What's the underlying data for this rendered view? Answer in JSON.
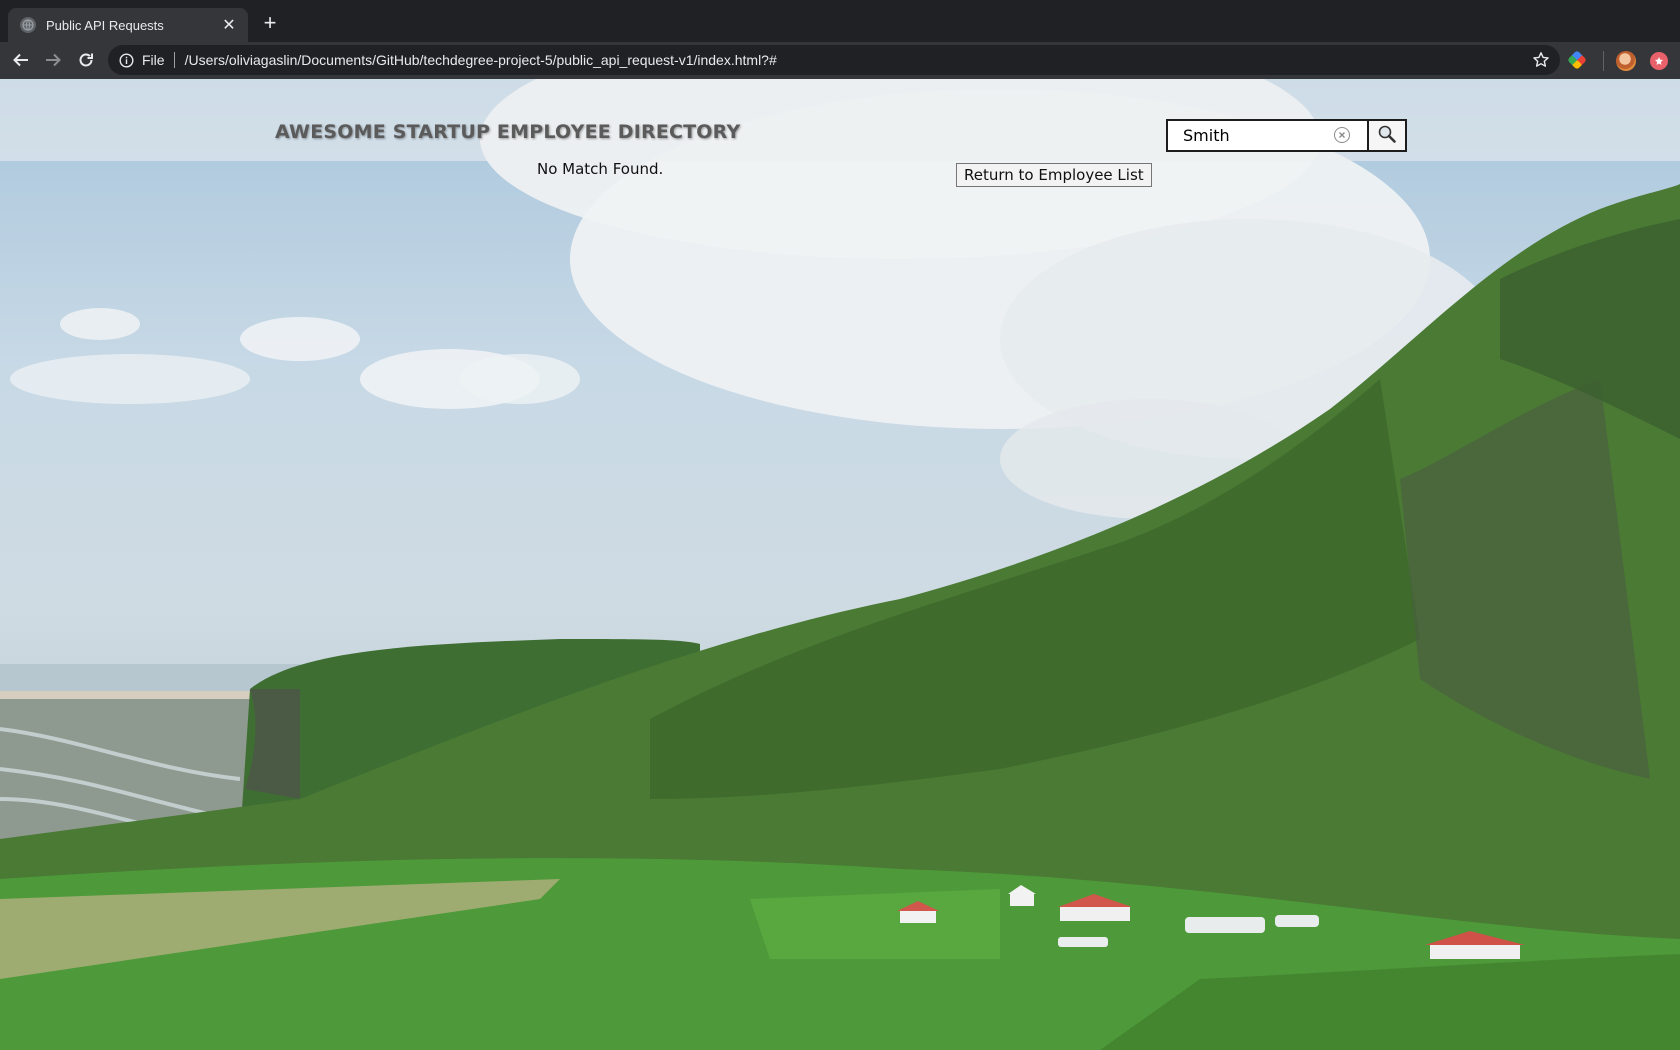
{
  "browser": {
    "tab": {
      "title": "Public API Requests",
      "close_glyph": "✕",
      "favicon": "globe-icon"
    },
    "new_tab_glyph": "+",
    "omnibox": {
      "security_label": "File",
      "url": "/Users/oliviagaslin/Documents/GitHub/techdegree-project-5/public_api_request-v1/index.html?#"
    },
    "nav": {
      "back": "back-arrow-icon",
      "forward": "forward-arrow-icon",
      "reload": "reload-icon"
    },
    "extensions": [
      "color-wheel-icon",
      "profile-avatar-icon",
      "red-badge-icon"
    ]
  },
  "page": {
    "title": "AWESOME STARTUP EMPLOYEE DIRECTORY",
    "search": {
      "value": "Smith",
      "button_icon": "search-icon"
    },
    "message": "No Match Found.",
    "return_button": "Return to Employee List"
  },
  "colors": {
    "chrome_dark": "#202124",
    "chrome_tab": "#35363a",
    "title_text": "#5b5b5b",
    "grass": "#4f8a3d",
    "sky": "#a9c6dc"
  }
}
